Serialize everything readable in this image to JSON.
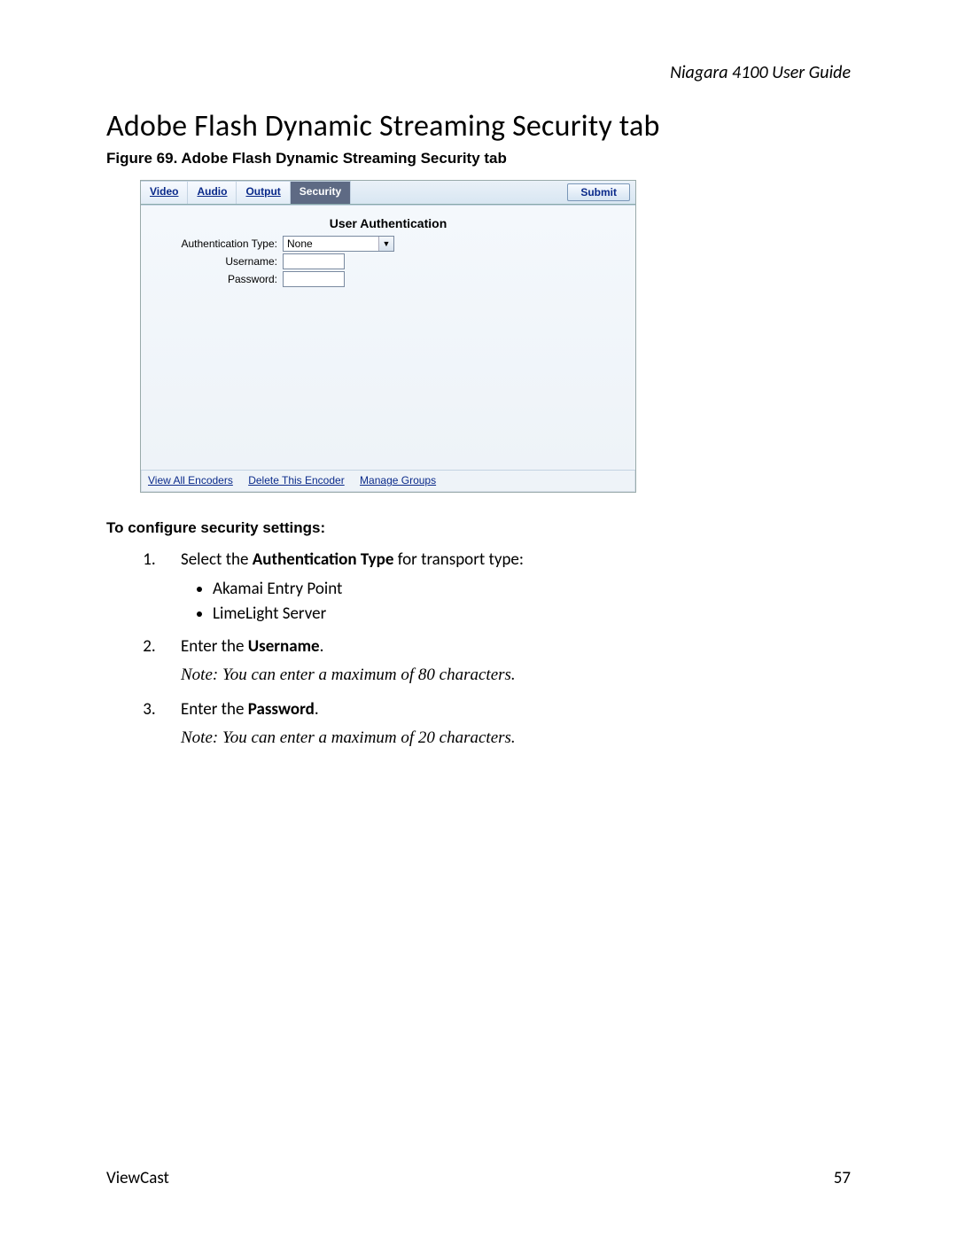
{
  "header": {
    "running_head": "Niagara 4100 User Guide"
  },
  "title": "Adobe Flash Dynamic Streaming Security tab",
  "figure": {
    "caption": "Figure 69. Adobe Flash Dynamic Streaming Security tab",
    "tabs": [
      "Video",
      "Audio",
      "Output",
      "Security"
    ],
    "active_tab": "Security",
    "submit_label": "Submit",
    "panel_heading": "User Authentication",
    "labels": {
      "auth_type": "Authentication Type:",
      "username": "Username:",
      "password": "Password:"
    },
    "auth_type_value": "None",
    "footer_links": [
      "View All Encoders",
      "Delete This Encoder",
      "Manage Groups"
    ]
  },
  "body": {
    "lead": "To configure security settings:",
    "step1_pre": "Select the ",
    "step1_bold": "Authentication Type",
    "step1_post": " for transport type:",
    "bullets": [
      "Akamai Entry Point",
      "LimeLight Server"
    ],
    "step2_pre": "Enter the ",
    "step2_bold": "Username",
    "dot": ".",
    "note2": "Note: You can enter a maximum of 80 characters.",
    "step3_pre": "Enter the ",
    "step3_bold": "Password",
    "note3": "Note: You can enter a maximum of 20 characters."
  },
  "footer": {
    "left": "ViewCast",
    "right": "57"
  }
}
